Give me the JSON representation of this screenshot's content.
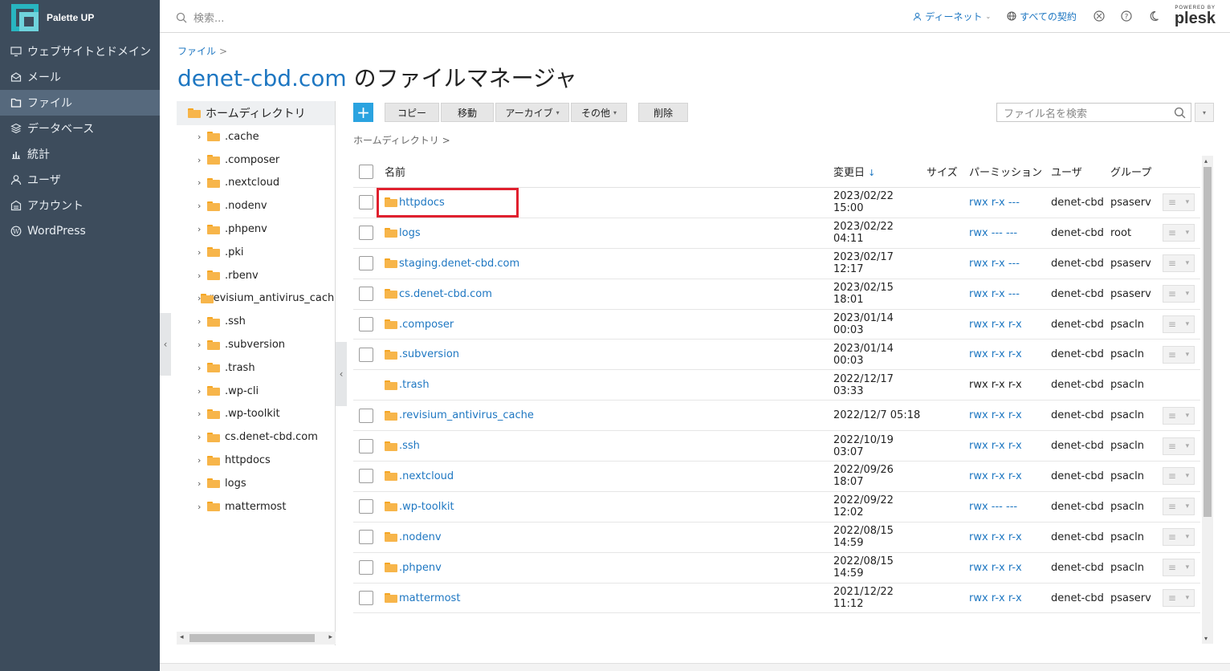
{
  "brand": {
    "name": "Palette UP"
  },
  "sidebar": {
    "items": [
      {
        "label": "ウェブサイトとドメイン",
        "icon": "monitor-icon",
        "active": false
      },
      {
        "label": "メール",
        "icon": "mail-icon",
        "active": false
      },
      {
        "label": "ファイル",
        "icon": "file-icon",
        "active": true
      },
      {
        "label": "データベース",
        "icon": "database-icon",
        "active": false
      },
      {
        "label": "統計",
        "icon": "stats-icon",
        "active": false
      },
      {
        "label": "ユーザ",
        "icon": "user-icon",
        "active": false
      },
      {
        "label": "アカウント",
        "icon": "account-icon",
        "active": false
      },
      {
        "label": "WordPress",
        "icon": "wordpress-icon",
        "active": false
      }
    ]
  },
  "topbar": {
    "search_placeholder": "検索...",
    "user_label": "ディーネット",
    "subscriptions_label": "すべての契約",
    "plesk_powered": "POWERED BY",
    "plesk_name": "plesk"
  },
  "breadcrumb": {
    "root": "ファイル",
    "sep": ">"
  },
  "title": {
    "domain": "denet-cbd.com",
    "suffix": " のファイルマネージャ"
  },
  "tree": {
    "root": "ホームディレクトリ",
    "items": [
      ".cache",
      ".composer",
      ".nextcloud",
      ".nodenv",
      ".phpenv",
      ".pki",
      ".rbenv",
      ".revisium_antivirus_cache",
      ".ssh",
      ".subversion",
      ".trash",
      ".wp-cli",
      ".wp-toolkit",
      "cs.denet-cbd.com",
      "httpdocs",
      "logs",
      "mattermost"
    ]
  },
  "toolbar": {
    "add": "+",
    "copy": "コピー",
    "move": "移動",
    "archive": "アーカイブ",
    "other": "その他",
    "delete": "削除",
    "file_search_placeholder": "ファイル名を検索"
  },
  "path": {
    "label": "ホームディレクトリ",
    "sep": ">"
  },
  "table": {
    "headers": {
      "name": "名前",
      "modified": "変更日",
      "sort_arrow": "↓",
      "size": "サイズ",
      "permission": "パーミッション",
      "user": "ユーザ",
      "group": "グループ"
    },
    "rows": [
      {
        "name": "httpdocs",
        "date": "2023/02/22 15:00",
        "perm": "rwx r-x ---",
        "user": "denet-cbd",
        "group": "psaserv",
        "checkbox": true,
        "perm_link": true,
        "actions": true
      },
      {
        "name": "logs",
        "date": "2023/02/22 04:11",
        "perm": "rwx --- ---",
        "user": "denet-cbd",
        "group": "root",
        "checkbox": true,
        "perm_link": true,
        "actions": true
      },
      {
        "name": "staging.denet-cbd.com",
        "date": "2023/02/17 12:17",
        "perm": "rwx r-x ---",
        "user": "denet-cbd",
        "group": "psaserv",
        "checkbox": true,
        "perm_link": true,
        "actions": true
      },
      {
        "name": "cs.denet-cbd.com",
        "date": "2023/02/15 18:01",
        "perm": "rwx r-x ---",
        "user": "denet-cbd",
        "group": "psaserv",
        "checkbox": true,
        "perm_link": true,
        "actions": true
      },
      {
        "name": ".composer",
        "date": "2023/01/14 00:03",
        "perm": "rwx r-x r-x",
        "user": "denet-cbd",
        "group": "psacln",
        "checkbox": true,
        "perm_link": true,
        "actions": true
      },
      {
        "name": ".subversion",
        "date": "2023/01/14 00:03",
        "perm": "rwx r-x r-x",
        "user": "denet-cbd",
        "group": "psacln",
        "checkbox": true,
        "perm_link": true,
        "actions": true
      },
      {
        "name": ".trash",
        "date": "2022/12/17 03:33",
        "perm": "rwx r-x r-x",
        "user": "denet-cbd",
        "group": "psacln",
        "checkbox": false,
        "perm_link": false,
        "actions": false
      },
      {
        "name": ".revisium_antivirus_cache",
        "date": "2022/12/7 05:18",
        "perm": "rwx r-x r-x",
        "user": "denet-cbd",
        "group": "psacln",
        "checkbox": true,
        "perm_link": true,
        "actions": true
      },
      {
        "name": ".ssh",
        "date": "2022/10/19 03:07",
        "perm": "rwx r-x r-x",
        "user": "denet-cbd",
        "group": "psacln",
        "checkbox": true,
        "perm_link": true,
        "actions": true
      },
      {
        "name": ".nextcloud",
        "date": "2022/09/26 18:07",
        "perm": "rwx r-x r-x",
        "user": "denet-cbd",
        "group": "psacln",
        "checkbox": true,
        "perm_link": true,
        "actions": true
      },
      {
        "name": ".wp-toolkit",
        "date": "2022/09/22 12:02",
        "perm": "rwx --- ---",
        "user": "denet-cbd",
        "group": "psacln",
        "checkbox": true,
        "perm_link": true,
        "actions": true
      },
      {
        "name": ".nodenv",
        "date": "2022/08/15 14:59",
        "perm": "rwx r-x r-x",
        "user": "denet-cbd",
        "group": "psacln",
        "checkbox": true,
        "perm_link": true,
        "actions": true
      },
      {
        "name": ".phpenv",
        "date": "2022/08/15 14:59",
        "perm": "rwx r-x r-x",
        "user": "denet-cbd",
        "group": "psacln",
        "checkbox": true,
        "perm_link": true,
        "actions": true
      },
      {
        "name": "mattermost",
        "date": "2021/12/22 11:12",
        "perm": "rwx r-x r-x",
        "user": "denet-cbd",
        "group": "psaserv",
        "checkbox": true,
        "perm_link": true,
        "actions": true
      }
    ]
  },
  "colors": {
    "sidebar_bg": "#3d4c5c",
    "accent": "#1e77c2",
    "highlight": "#e0202e",
    "folder": "#f7b54a"
  }
}
